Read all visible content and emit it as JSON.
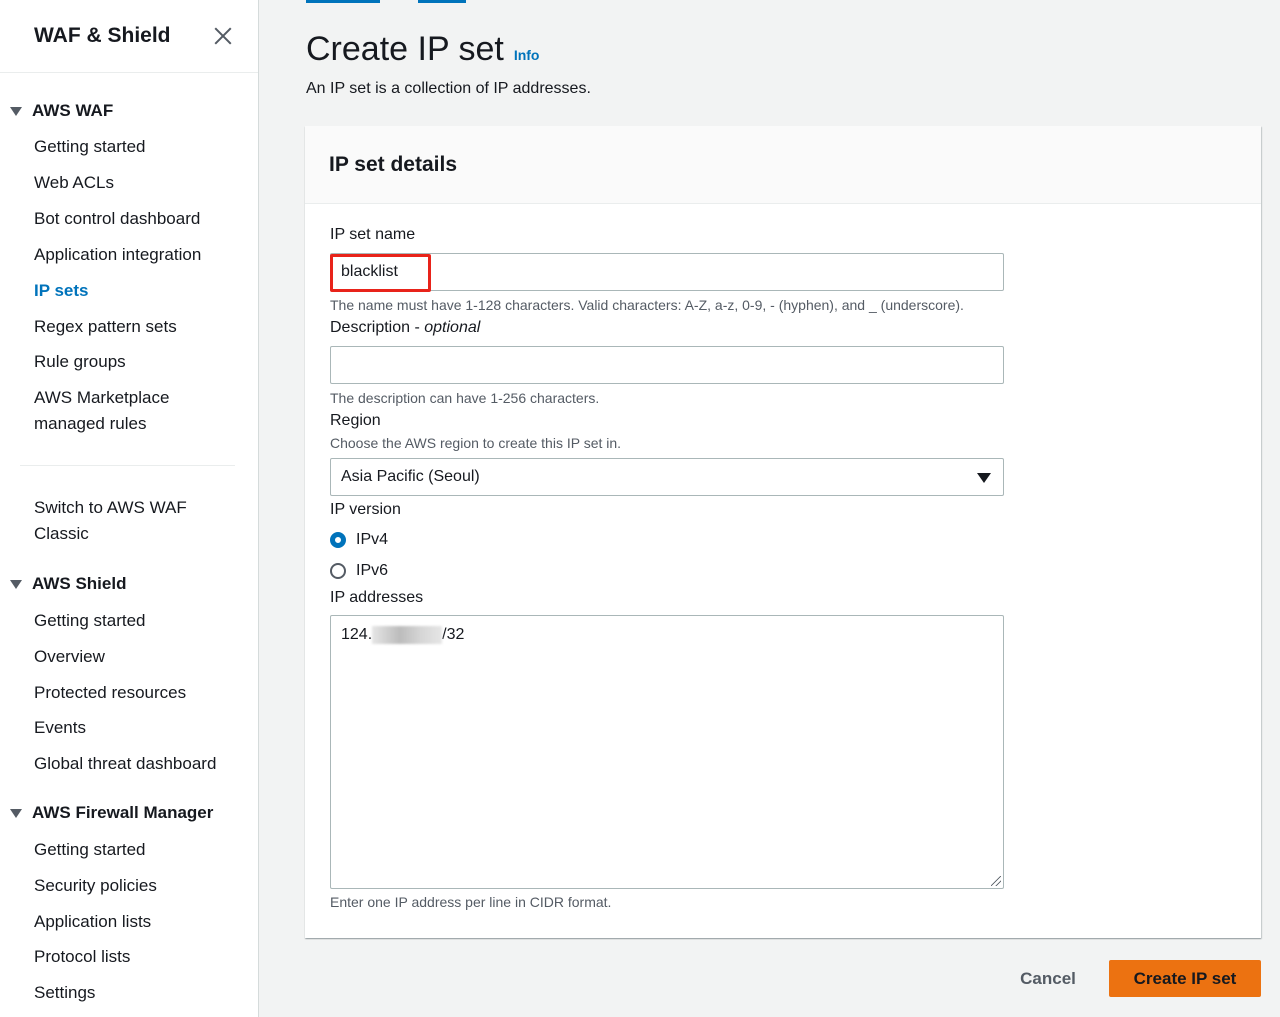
{
  "sidebar": {
    "title": "WAF & Shield",
    "waf_section": "AWS WAF",
    "waf_items": [
      "Getting started",
      "Web ACLs",
      "Bot control dashboard",
      "Application integration",
      "IP sets",
      "Regex pattern sets",
      "Rule groups",
      "AWS Marketplace",
      "managed rules"
    ],
    "switch_classic": [
      "Switch to AWS WAF",
      "Classic"
    ],
    "shield_section": "AWS Shield",
    "shield_items": [
      "Getting started",
      "Overview",
      "Protected resources",
      "Events",
      "Global threat dashboard"
    ],
    "fm_section": "AWS Firewall Manager",
    "fm_items": [
      "Getting started",
      "Security policies",
      "Application lists",
      "Protocol lists",
      "Settings"
    ]
  },
  "header": {
    "title": "Create IP set",
    "info": "Info",
    "description": "An IP set is a collection of IP addresses."
  },
  "card": {
    "title": "IP set details",
    "name_label": "IP set name",
    "name_value": "blacklist",
    "name_hint": "The name must have 1-128 characters. Valid characters: A-Z, a-z, 0-9, - (hyphen), and _ (underscore).",
    "desc_label": "Description - ",
    "desc_optional": "optional",
    "desc_value": "",
    "desc_hint": "The description can have 1-256 characters.",
    "region_label": "Region",
    "region_hint": "Choose the AWS region to create this IP set in.",
    "region_value": "Asia Pacific (Seoul)",
    "ipversion_label": "IP version",
    "ipv4": "IPv4",
    "ipv6": "IPv6",
    "ipv4_checked": true,
    "addresses_label": "IP addresses",
    "address_prefix": "124.",
    "address_suffix": "/32",
    "addresses_hint": "Enter one IP address per line in CIDR format."
  },
  "actions": {
    "cancel": "Cancel",
    "create": "Create IP set"
  },
  "colors": {
    "link": "#0073bb",
    "primary_button": "#ec7211",
    "highlight": "#e8231a"
  }
}
